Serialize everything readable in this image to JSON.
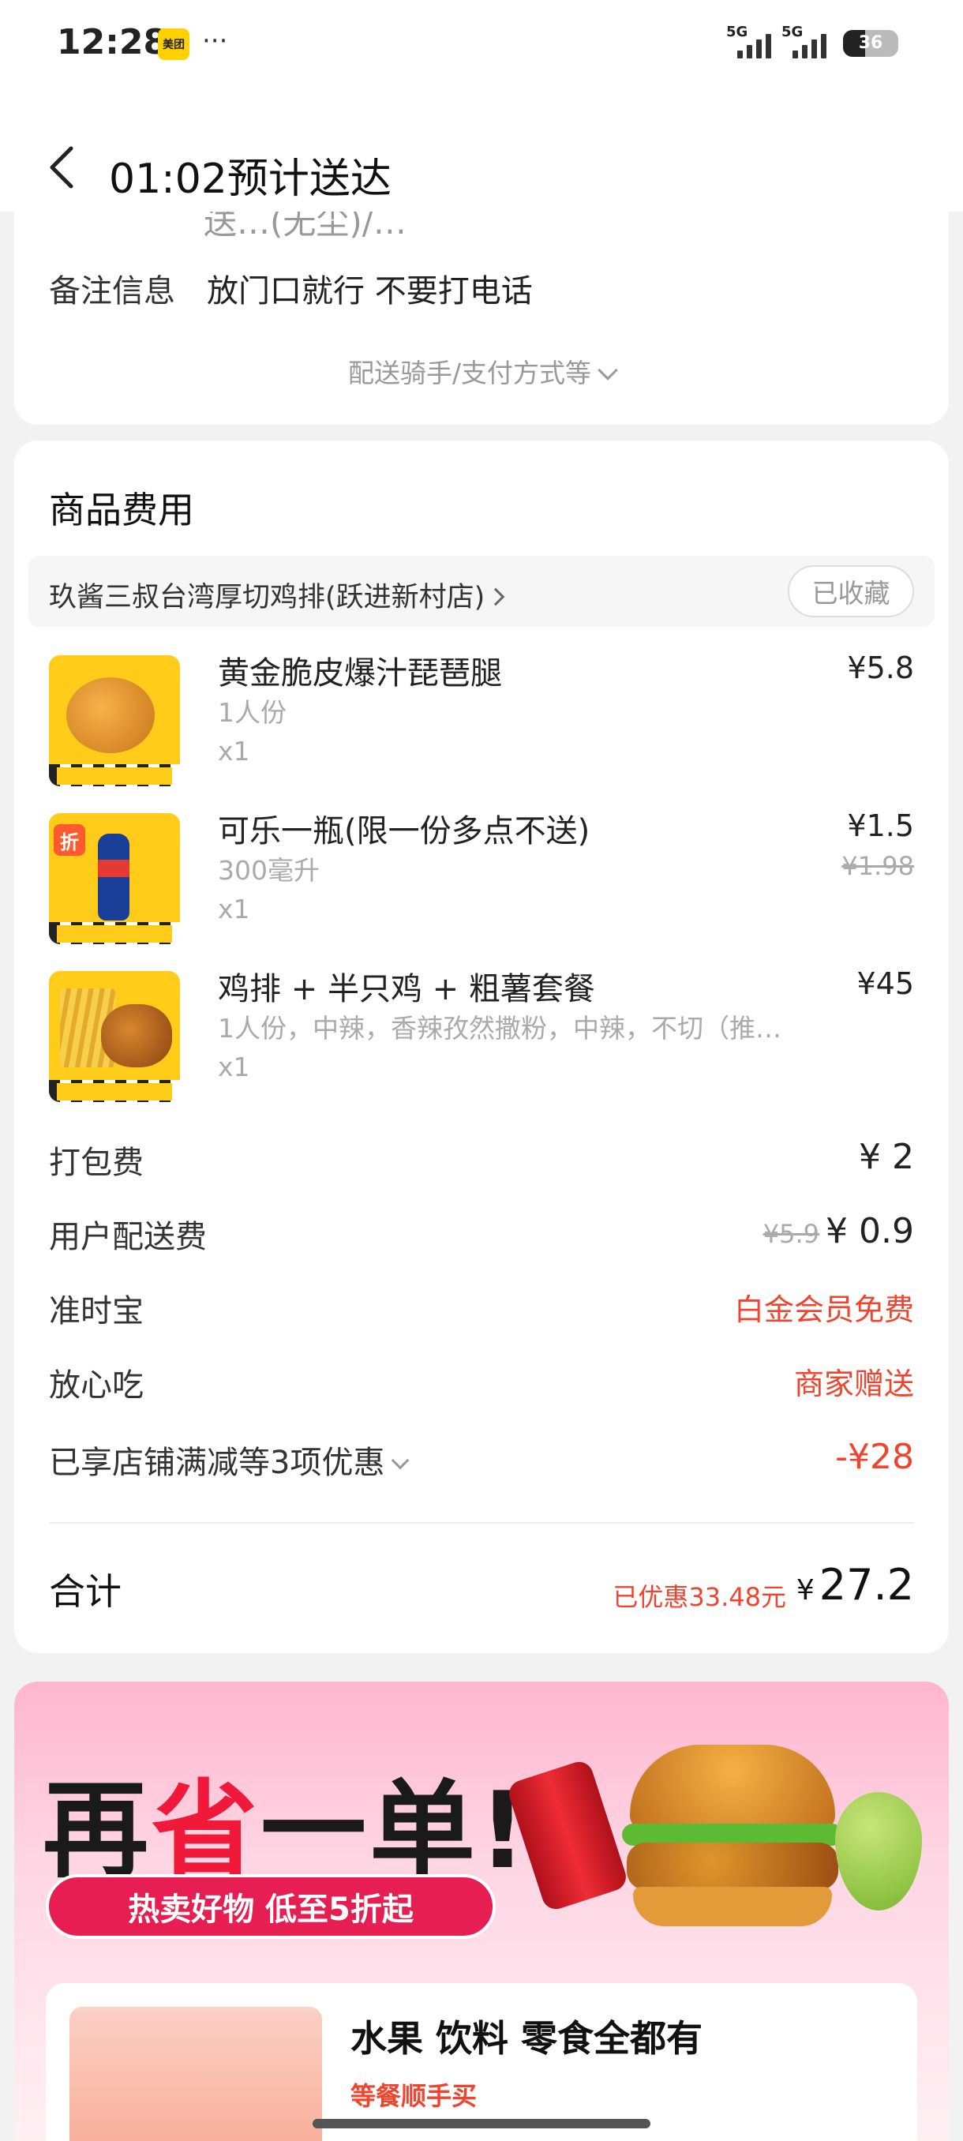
{
  "status_bar": {
    "time": "12:28",
    "app_badge": "美团",
    "more": "···",
    "signal1_label": "5G",
    "signal2_label": "5G",
    "battery": "36"
  },
  "header": {
    "title": "01:02预计送达"
  },
  "order_info": {
    "cut_off_text": "送…(无尘)/…",
    "remark_label": "备注信息",
    "remark_value": "放门口就行 不要打电话",
    "more_info": "配送骑手/支付方式等"
  },
  "goods": {
    "section_title": "商品费用",
    "store_name": "玖酱三叔台湾厚切鸡排(跃进新村店)",
    "favorite_label": "已收藏",
    "items": [
      {
        "name": "黄金脆皮爆汁琵琶腿",
        "spec": "1人份",
        "qty": "x1",
        "price": "¥5.8",
        "original_price": ""
      },
      {
        "name": "可乐一瓶(限一份多点不送)",
        "spec": "300毫升",
        "qty": "x1",
        "price": "¥1.5",
        "original_price": "¥1.98",
        "badge": "折"
      },
      {
        "name": "鸡排 + 半只鸡 + 粗薯套餐",
        "spec": "1人份，中辣，香辣孜然撒粉，中辣，不切（推…",
        "qty": "x1",
        "price": "¥45",
        "original_price": ""
      }
    ],
    "fees": {
      "packing_label": "打包费",
      "packing_value": "¥ 2",
      "delivery_label": "用户配送费",
      "delivery_original": "¥5.9",
      "delivery_value": "¥ 0.9",
      "ontime_label": "准时宝",
      "ontime_value": "白金会员免费",
      "safe_label": "放心吃",
      "safe_value": "商家赠送",
      "discount_label": "已享店铺满减等3项优惠",
      "discount_value": "-¥28"
    },
    "total_label": "合计",
    "saved_text": "已优惠33.48元",
    "total_currency": "¥",
    "total_value": "27.2"
  },
  "promo": {
    "title_a": "再",
    "title_b": "省",
    "title_c": "一单!",
    "pill": "热卖好物 低至5折起",
    "card_title": "水果 饮料 零食全都有",
    "card_sub": "等餐顺手买"
  },
  "colors": {
    "accent_red": "#f0442e",
    "promo_pink": "#e61e51",
    "brand_yellow": "#ffd100"
  }
}
